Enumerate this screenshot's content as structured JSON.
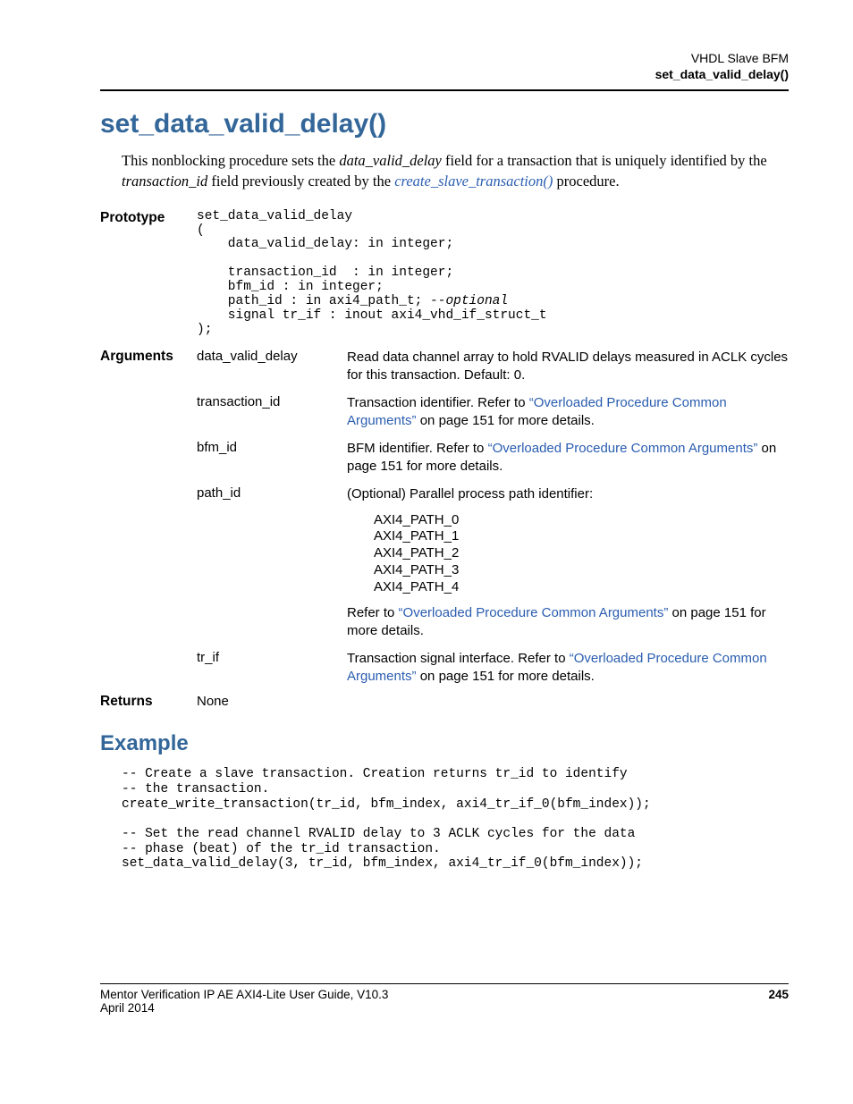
{
  "header": {
    "line1": "VHDL Slave BFM",
    "line2": "set_data_valid_delay()"
  },
  "title": "set_data_valid_delay()",
  "intro": {
    "part1": "This nonblocking procedure sets the ",
    "italic1": "data_valid_delay",
    "part2": " field for a transaction that is uniquely identified by the ",
    "italic2": "transaction_id",
    "part3": " field previously created by the ",
    "link": "create_slave_transaction()",
    "part4": " procedure."
  },
  "prototype": {
    "label": "Prototype",
    "code_l1": "set_data_valid_delay",
    "code_l2": "(",
    "code_l3": "    data_valid_delay: in integer;",
    "code_l4": "",
    "code_l5": "    transaction_id  : in integer;",
    "code_l6": "    bfm_id : in integer;",
    "code_l7a": "    path_id : in axi4_path_t; ",
    "code_l7b": "--optional",
    "code_l8": "    signal tr_if : inout axi4_vhd_if_struct_t",
    "code_l9": ");"
  },
  "arguments": {
    "label": "Arguments",
    "rows": [
      {
        "name": "data_valid_delay",
        "desc": "Read data channel array to hold RVALID delays measured in ACLK cycles for this transaction. Default: 0."
      },
      {
        "name": "transaction_id",
        "desc_pre": "Transaction identifier. Refer to ",
        "q1": "“",
        "link": "Overloaded Procedure Common Arguments",
        "q2": "”",
        "desc_post": " on page 151 for more details."
      },
      {
        "name": "bfm_id",
        "desc_pre": "BFM identifier. Refer to ",
        "q1": "“",
        "link": "Overloaded Procedure Common Arguments",
        "q2": "”",
        "desc_post": " on page 151 for more details."
      },
      {
        "name": "path_id",
        "desc": "(Optional) Parallel process path identifier:"
      },
      {
        "name": "tr_if",
        "desc_pre": "Transaction signal interface. Refer to ",
        "q1": "“",
        "link": "Overloaded Procedure Common Arguments",
        "q2": "”",
        "desc_post": " on page 151 for more details."
      }
    ],
    "paths": {
      "p0": "AXI4_PATH_0",
      "p1": "AXI4_PATH_1",
      "p2": "AXI4_PATH_2",
      "p3": "AXI4_PATH_3",
      "p4": "AXI4_PATH_4"
    },
    "path_ref_pre": "Refer to ",
    "path_ref_q1": "“",
    "path_ref_link": "Overloaded Procedure Common Arguments",
    "path_ref_q2": "”",
    "path_ref_post": " on page 151 for more details."
  },
  "returns": {
    "label": "Returns",
    "value": "None"
  },
  "example": {
    "title": "Example",
    "code": "-- Create a slave transaction. Creation returns tr_id to identify\n-- the transaction.\ncreate_write_transaction(tr_id, bfm_index, axi4_tr_if_0(bfm_index));\n\n-- Set the read channel RVALID delay to 3 ACLK cycles for the data\n-- phase (beat) of the tr_id transaction.\nset_data_valid_delay(3, tr_id, bfm_index, axi4_tr_if_0(bfm_index));"
  },
  "footer": {
    "left": "Mentor Verification IP AE AXI4-Lite User Guide, V10.3",
    "date": "April 2014",
    "page": "245"
  }
}
